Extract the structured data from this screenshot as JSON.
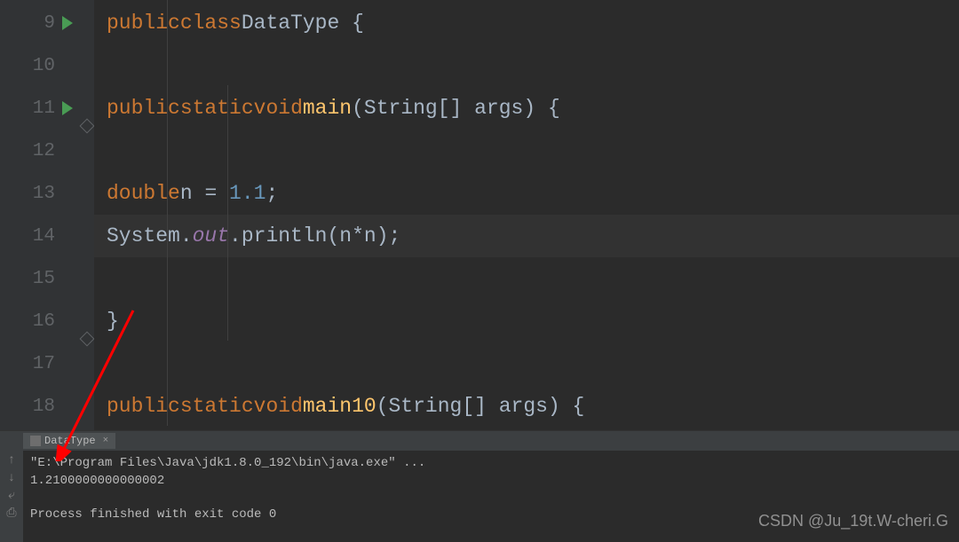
{
  "gutter": {
    "lines": [
      "9",
      "10",
      "11",
      "12",
      "13",
      "14",
      "15",
      "16",
      "17",
      "18"
    ]
  },
  "code": {
    "line9": {
      "kw1": "public",
      "kw2": "class",
      "cls": "DataType",
      "brace": " {"
    },
    "line11": {
      "kw1": "public",
      "kw2": "static",
      "kw3": "void",
      "fn": "main",
      "sig1": "(String[] ",
      "arg": "args",
      "sig2": ") {"
    },
    "line13": {
      "type": "double",
      "var": "n ",
      "eq": "= ",
      "val": "1.1",
      "semi": ";"
    },
    "line14": {
      "sys": "System.",
      "out": "out",
      "dot": ".println(",
      "arg": "n*n",
      "end": ");"
    },
    "line16": {
      "brace": "}"
    },
    "line18": {
      "kw1": "public",
      "kw2": "static",
      "kw3": "void",
      "fn": "main10",
      "sig1": "(String[] ",
      "arg": "args",
      "sig2": ") {"
    }
  },
  "console": {
    "tab": "DataType",
    "cmd": "\"E:\\Program Files\\Java\\jdk1.8.0_192\\bin\\java.exe\" ...",
    "output": "1.2100000000000002",
    "exit": "Process finished with exit code 0"
  },
  "watermark": "CSDN @Ju_19t.W-cheri.G"
}
